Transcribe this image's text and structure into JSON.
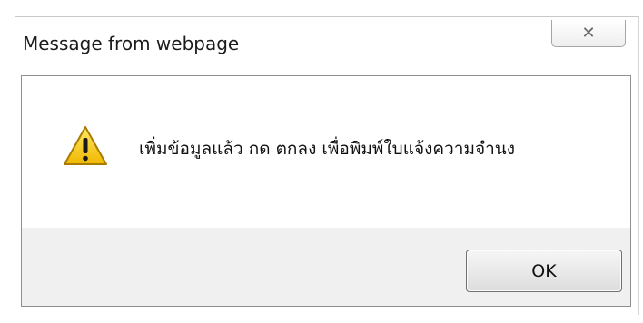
{
  "dialog": {
    "title": "Message from webpage",
    "close_glyph": "✕",
    "message": "เพิ่มข้อมูลแล้ว กด ตกลง เพื่อพิมพ์ใบแจ้งความจำนง",
    "ok_label": "OK",
    "icon": "warning-icon",
    "accent_colors": {
      "warning_yellow": "#f5c400",
      "footer_bg": "#f0f0f0"
    }
  }
}
